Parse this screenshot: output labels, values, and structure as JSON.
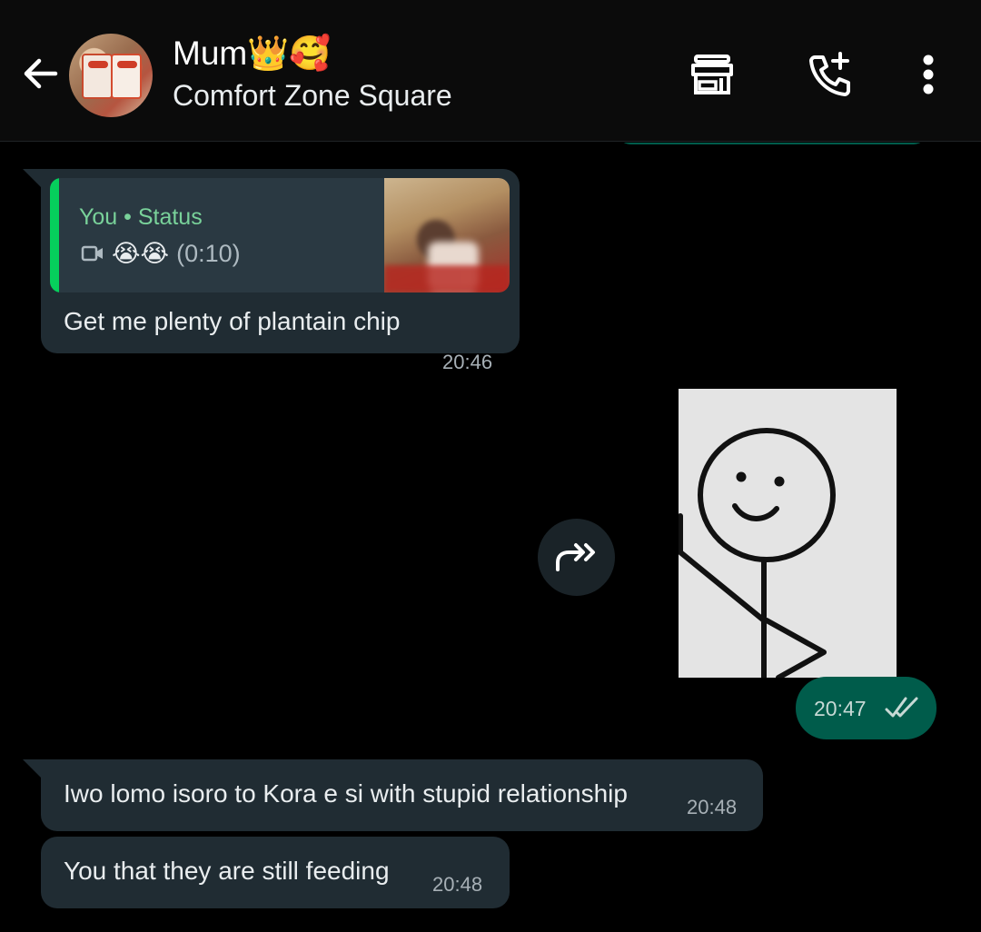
{
  "header": {
    "contact_name": "Mum👑🥰",
    "subtitle": "Comfort Zone Square",
    "back_icon": "arrow-left-icon",
    "store_icon": "storefront-icon",
    "call_icon": "add-call-icon",
    "menu_icon": "more-vertical-icon"
  },
  "messages": {
    "m1": {
      "reply_title": "You • Status",
      "reply_emoji": "😭😭",
      "reply_duration": "(0:10)",
      "text": "Get me plenty of plantain chip",
      "time": "20:46"
    },
    "m2": {
      "time": "20:47",
      "status": "read"
    },
    "m3": {
      "text": "Iwo lomo isoro to Kora e si with stupid relationship",
      "time": "20:48"
    },
    "m4": {
      "text": "You that they are still feeding",
      "time": "20:48"
    }
  },
  "colors": {
    "background": "#000000",
    "incoming_bubble": "#202c33",
    "outgoing_bubble": "#005c4b",
    "quote_accent": "#06cf5c",
    "read_ticks": "#c7d9d5"
  }
}
